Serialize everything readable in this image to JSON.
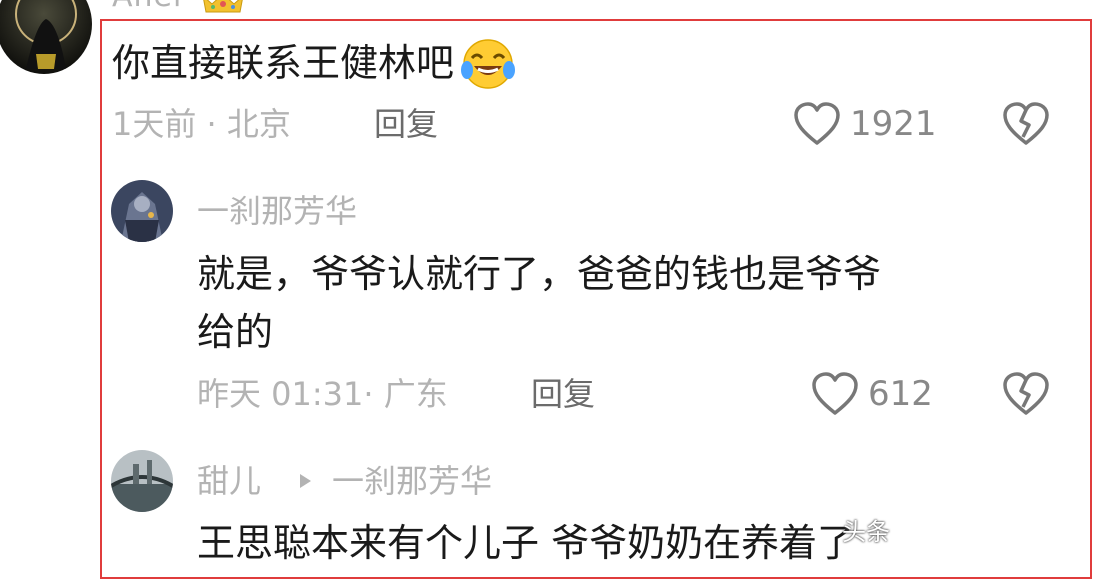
{
  "top": {
    "username": "Anei"
  },
  "comment": {
    "text": "你直接联系王健林吧",
    "meta": "1天前 · 北京",
    "reply": "回复",
    "likes": "1921"
  },
  "reply1": {
    "username": "一刹那芳华",
    "text_line1": "就是，爷爷认就行了，爸爸的钱也是爷爷",
    "text_line2": "给的",
    "meta": "昨天 01:31· 广东",
    "reply": "回复",
    "likes": "612"
  },
  "reply2": {
    "username": "甜儿",
    "reply_to": "一刹那芳华",
    "text": "王思聪本来有个儿子 爷爷奶奶在养着了"
  },
  "watermark": "头条",
  "colors": {
    "highlight_border": "#e03c3c",
    "meta_gray": "#b3b3b3",
    "text": "#1a1a1a"
  }
}
